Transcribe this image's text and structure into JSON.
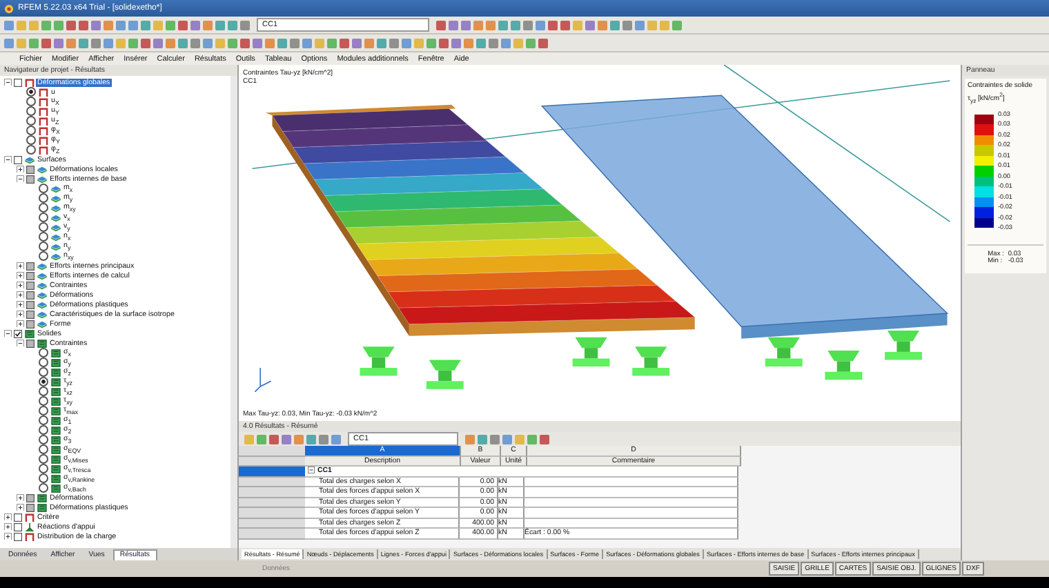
{
  "window": {
    "title": "RFEM 5.22.03 x64 Trial - [solidexetho*]"
  },
  "toolbar": {
    "load_case": "CC1"
  },
  "menu": [
    "Fichier",
    "Modifier",
    "Afficher",
    "Insérer",
    "Calculer",
    "Résultats",
    "Outils",
    "Tableau",
    "Options",
    "Modules additionnels",
    "Fenêtre",
    "Aide"
  ],
  "navigator": {
    "title": "Navigateur de projet - Résultats",
    "tree": [
      {
        "label": "Déformations globales",
        "kind": "frame",
        "checked": false,
        "partial": false,
        "expanded": true,
        "highlighted": true,
        "children": [
          {
            "label": "u",
            "kind": "frame",
            "selected": true
          },
          {
            "label": "u$_{X}$",
            "kind": "frame",
            "selected": false
          },
          {
            "label": "u$_{Y}$",
            "kind": "frame",
            "selected": false
          },
          {
            "label": "u$_{Z}$",
            "kind": "frame",
            "selected": false
          },
          {
            "label": "φ$_{X}$",
            "kind": "frame",
            "selected": false
          },
          {
            "label": "φ$_{Y}$",
            "kind": "frame",
            "selected": false
          },
          {
            "label": "φ$_{Z}$",
            "kind": "frame",
            "selected": false
          }
        ]
      },
      {
        "label": "Surfaces",
        "kind": "surface",
        "checked": false,
        "partial": false,
        "expanded": true,
        "highlighted": false,
        "children": [
          {
            "label": "Déformations locales",
            "kind": "surface",
            "checked": false,
            "partial": true,
            "expanded": false,
            "highlighted": false
          },
          {
            "label": "Efforts internes de base",
            "kind": "surface",
            "checked": false,
            "partial": true,
            "expanded": true,
            "highlighted": false,
            "children": [
              {
                "label": "m$_{x}$",
                "kind": "surface",
                "selected": false
              },
              {
                "label": "m$_{y}$",
                "kind": "surface",
                "selected": false
              },
              {
                "label": "m$_{xy}$",
                "kind": "surface",
                "selected": false
              },
              {
                "label": "v$_{x}$",
                "kind": "surface",
                "selected": false
              },
              {
                "label": "v$_{y}$",
                "kind": "surface",
                "selected": false
              },
              {
                "label": "n$_{x}$",
                "kind": "surface",
                "selected": false
              },
              {
                "label": "n$_{y}$",
                "kind": "surface",
                "selected": false
              },
              {
                "label": "n$_{xy}$",
                "kind": "surface",
                "selected": false
              }
            ]
          },
          {
            "label": "Efforts internes principaux",
            "kind": "surface",
            "checked": false,
            "partial": true,
            "expanded": false,
            "highlighted": false
          },
          {
            "label": "Efforts internes de calcul",
            "kind": "surface",
            "checked": false,
            "partial": true,
            "expanded": false,
            "highlighted": false
          },
          {
            "label": "Contraintes",
            "kind": "surface",
            "checked": false,
            "partial": true,
            "expanded": false,
            "highlighted": false
          },
          {
            "label": "Déformations",
            "kind": "surface",
            "checked": false,
            "partial": true,
            "expanded": false,
            "highlighted": false
          },
          {
            "label": "Déformations plastiques",
            "kind": "surface",
            "checked": false,
            "partial": true,
            "expanded": false,
            "highlighted": false
          },
          {
            "label": "Caractéristiques de la surface isotrope",
            "kind": "surface",
            "checked": false,
            "partial": true,
            "expanded": false,
            "highlighted": false
          },
          {
            "label": "Forme",
            "kind": "surface",
            "checked": false,
            "partial": true,
            "expanded": false,
            "highlighted": false
          }
        ]
      },
      {
        "label": "Solides",
        "kind": "solid",
        "checked": true,
        "partial": false,
        "expanded": true,
        "highlighted": false,
        "children": [
          {
            "label": "Contraintes",
            "kind": "solid",
            "checked": false,
            "partial": true,
            "expanded": true,
            "highlighted": false,
            "children": [
              {
                "label": "σ$_{x}$",
                "kind": "solid",
                "selected": false
              },
              {
                "label": "σ$_{y}$",
                "kind": "solid",
                "selected": false
              },
              {
                "label": "σ$_{z}$",
                "kind": "solid",
                "selected": false
              },
              {
                "label": "τ$_{yz}$",
                "kind": "solid",
                "selected": true
              },
              {
                "label": "τ$_{xz}$",
                "kind": "solid",
                "selected": false
              },
              {
                "label": "τ$_{xy}$",
                "kind": "solid",
                "selected": false
              },
              {
                "label": "τ$_{max}$",
                "kind": "solid",
                "selected": false
              },
              {
                "label": "σ$_{1}$",
                "kind": "solid",
                "selected": false
              },
              {
                "label": "σ$_{2}$",
                "kind": "solid",
                "selected": false
              },
              {
                "label": "σ$_{3}$",
                "kind": "solid",
                "selected": false
              },
              {
                "label": "σ$_{EQV}$",
                "kind": "solid",
                "selected": false
              },
              {
                "label": "σ$_{v,Mises}$",
                "kind": "solid",
                "selected": false
              },
              {
                "label": "σ$_{v,Tresca}$",
                "kind": "solid",
                "selected": false
              },
              {
                "label": "σ$_{v,Rankine}$",
                "kind": "solid",
                "selected": false
              },
              {
                "label": "σ$_{v,Bach}$",
                "kind": "solid",
                "selected": false
              }
            ]
          },
          {
            "label": "Déformations",
            "kind": "solid",
            "checked": false,
            "partial": true,
            "expanded": false,
            "highlighted": false
          },
          {
            "label": "Déformations plastiques",
            "kind": "solid",
            "checked": false,
            "partial": true,
            "expanded": false,
            "highlighted": false
          }
        ]
      },
      {
        "label": "Critère",
        "kind": "frame",
        "checked": false,
        "partial": false,
        "expanded": false,
        "highlighted": false
      },
      {
        "label": "Réactions d'appui",
        "kind": "support",
        "checked": false,
        "partial": false,
        "expanded": false,
        "highlighted": false
      },
      {
        "label": "Distribution de la charge",
        "kind": "frame",
        "checked": false,
        "partial": false,
        "expanded": false,
        "highlighted": false
      }
    ],
    "tabs": [
      {
        "label": "Données",
        "selected": false
      },
      {
        "label": "Afficher",
        "selected": false
      },
      {
        "label": "Vues",
        "selected": false
      },
      {
        "label": "Résultats",
        "selected": true
      }
    ]
  },
  "viewport": {
    "title": "Contraintes Tau-yz [kN/cm^2]",
    "load_case": "CC1",
    "summary": "Max Tau-yz: 0.03, Min Tau-yz: -0.03 kN/m^2"
  },
  "panel": {
    "title": "Panneau",
    "heading": "Contraintes de solide",
    "unit": "τ$_{yz}$ [kN/cm$^{2}$]",
    "bands": [
      {
        "color": "#a00010"
      },
      {
        "color": "#e01010"
      },
      {
        "color": "#f08c00"
      },
      {
        "color": "#c8c800"
      },
      {
        "color": "#f0f000"
      },
      {
        "color": "#00d000"
      },
      {
        "color": "#00c080"
      },
      {
        "color": "#00e0e0"
      },
      {
        "color": "#0090f0"
      },
      {
        "color": "#0020e0"
      },
      {
        "color": "#000090"
      }
    ],
    "ticks": [
      "0.03",
      "0.03",
      "0.02",
      "0.02",
      "0.01",
      "0.01",
      "0.00",
      "-0.01",
      "-0.01",
      "-0.02",
      "-0.02",
      "-0.03"
    ],
    "max_label": "Max :",
    "max": "0.03",
    "min_label": "Min :",
    "min": "-0.03"
  },
  "results": {
    "title": "4.0 Résultats - Résumé",
    "load_case": "CC1",
    "column_letters": [
      "A",
      "B",
      "C",
      "D"
    ],
    "columns": [
      "Description",
      "Valeur",
      "Unité",
      "Commentaire"
    ],
    "group": "CC1",
    "rows": [
      {
        "description": "Total des charges selon X",
        "value": "0.00",
        "unit": "kN",
        "comment": ""
      },
      {
        "description": "Total des forces d'appui selon X",
        "value": "0.00",
        "unit": "kN",
        "comment": ""
      },
      {
        "description": "Total des charges selon Y",
        "value": "0.00",
        "unit": "kN",
        "comment": ""
      },
      {
        "description": "Total des forces d'appui selon Y",
        "value": "0.00",
        "unit": "kN",
        "comment": ""
      },
      {
        "description": "Total des charges selon Z",
        "value": "400.00",
        "unit": "kN",
        "comment": ""
      },
      {
        "description": "Total des forces d'appui selon Z",
        "value": "400.00",
        "unit": "kN",
        "comment": "Écart : 0.00 %"
      }
    ],
    "tabs": [
      {
        "label": "Résultats - Résumé",
        "selected": true
      },
      {
        "label": "Nœuds - Déplacements",
        "selected": false
      },
      {
        "label": "Lignes - Forces d'appui",
        "selected": false
      },
      {
        "label": "Surfaces - Déformations locales",
        "selected": false
      },
      {
        "label": "Surfaces - Forme",
        "selected": false
      },
      {
        "label": "Surfaces - Déformations globales",
        "selected": false
      },
      {
        "label": "Surfaces - Efforts internes de base",
        "selected": false
      },
      {
        "label": "Surfaces - Efforts internes principaux",
        "selected": false
      }
    ]
  },
  "status_bar": {
    "message": "Données",
    "toggles": [
      {
        "label": "SAISIE",
        "on": false
      },
      {
        "label": "GRILLE",
        "on": false
      },
      {
        "label": "CARTES",
        "on": false
      },
      {
        "label": "SAISIE OBJ.",
        "on": false
      },
      {
        "label": "GLIGNES",
        "on": false
      },
      {
        "label": "DXF",
        "on": false
      }
    ]
  }
}
